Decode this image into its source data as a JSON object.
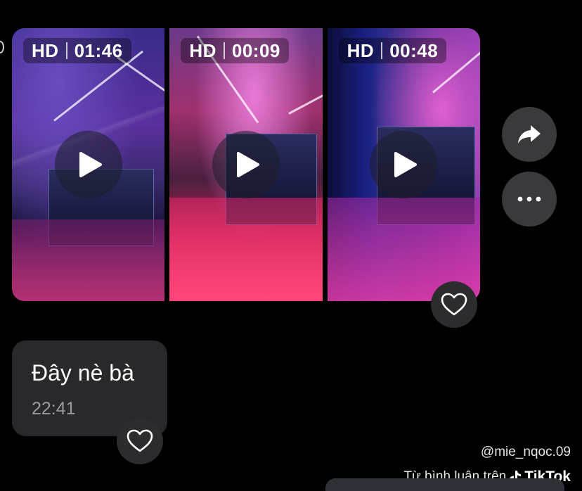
{
  "videos": [
    {
      "quality": "HD",
      "duration": "01:46",
      "play_icon": "play-icon"
    },
    {
      "quality": "HD",
      "duration": "00:09",
      "play_icon": "play-icon"
    },
    {
      "quality": "HD",
      "duration": "00:48",
      "play_icon": "play-icon"
    }
  ],
  "actions": {
    "share_icon": "share-icon",
    "more_icon": "more-icon",
    "like_icon": "heart-icon"
  },
  "message": {
    "text": "Đây nè bà",
    "time": "22:41"
  },
  "watermark": {
    "username": "@mie_nqoc.09",
    "source_text": "Từ bình luận trên",
    "brand": "TikTok"
  },
  "colors": {
    "background": "#000000",
    "bubble": "#29292b",
    "button": "#3a3a3c",
    "timestamp": "#9b9b9f"
  }
}
